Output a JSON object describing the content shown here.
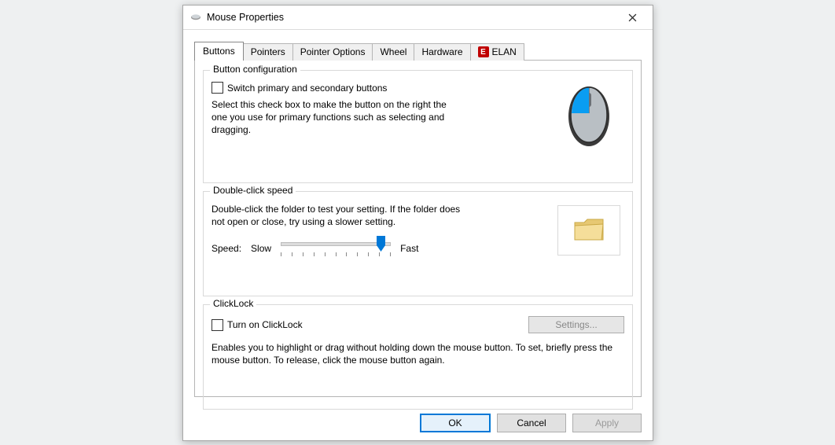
{
  "title": "Mouse Properties",
  "tabs": {
    "buttons": "Buttons",
    "pointers": "Pointers",
    "pointer_options": "Pointer Options",
    "wheel": "Wheel",
    "hardware": "Hardware",
    "elan": "ELAN"
  },
  "button_config": {
    "legend": "Button configuration",
    "checkbox_label": "Switch primary and secondary buttons",
    "description": "Select this check box to make the button on the right the one you use for primary functions such as selecting and dragging."
  },
  "double_click": {
    "legend": "Double-click speed",
    "description": "Double-click the folder to test your setting. If the folder does not open or close, try using a slower setting.",
    "speed_label": "Speed:",
    "slow": "Slow",
    "fast": "Fast"
  },
  "clicklock": {
    "legend": "ClickLock",
    "checkbox_label": "Turn on ClickLock",
    "settings_button": "Settings...",
    "description": "Enables you to highlight or drag without holding down the mouse button. To set, briefly press the mouse button. To release, click the mouse button again."
  },
  "buttons_footer": {
    "ok": "OK",
    "cancel": "Cancel",
    "apply": "Apply"
  }
}
